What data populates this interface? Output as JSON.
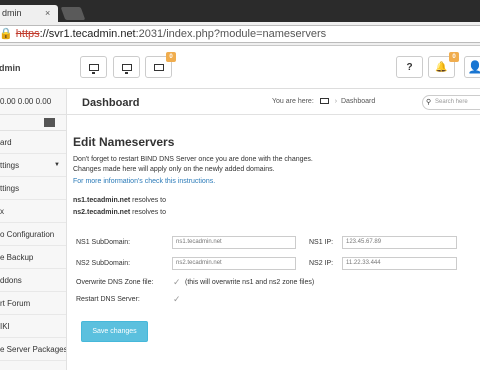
{
  "browser": {
    "tab_title": "dmin",
    "tab_close": "×",
    "url_lock": "🔒",
    "url_scheme": "https",
    "url_host": "://svr1.tecadmin.net",
    "url_rest": ":2031/index.php?module=nameservers"
  },
  "header": {
    "brand": "dmin",
    "badge_left": "0",
    "badge_right": "0",
    "help_label": "?"
  },
  "sidebar": {
    "load": "0.00 0.00 0.00",
    "items": [
      {
        "label": "ard"
      },
      {
        "label": "ttings"
      },
      {
        "label": "ttings"
      },
      {
        "label": "x"
      },
      {
        "label": "o Configuration"
      },
      {
        "label": "e Backup"
      },
      {
        "label": "ddons"
      },
      {
        "label": "rt Forum"
      },
      {
        "label": "IKI"
      },
      {
        "label": "e Server Packages"
      }
    ]
  },
  "breadcrumb": {
    "title": "Dashboard",
    "you_are_here": "You are here:",
    "sep": "›",
    "current": "Dashboard",
    "search_placeholder": "Search here"
  },
  "main": {
    "heading": "Edit Nameservers",
    "note1": "Don't forget to restart BIND DNS Server once you are done with the changes.",
    "note2": "Changes made here will apply only on the newly added domains.",
    "more_link": "For more information's check this instructions.",
    "ns1_host": "ns1.tecadmin.net",
    "ns2_host": "ns2.tecadmin.net",
    "resolves_to": "resolves to",
    "ns1_sub_label": "NS1 SubDomain:",
    "ns1_sub_value": "ns1.tecadmin.net",
    "ns1_ip_label": "NS1 IP:",
    "ns1_ip_value": "123.45.67.89",
    "ns2_sub_label": "NS2 SubDomain:",
    "ns2_sub_value": "ns2.tecadmin.net",
    "ns2_ip_label": "NS2 IP:",
    "ns2_ip_value": "11.22.33.444",
    "overwrite_label": "Overwrite DNS Zone file:",
    "overwrite_note": "(this will overwrite ns1 and ns2 zone files)",
    "restart_label": "Restart DNS Server:",
    "check_mark": "✓",
    "save_label": "Save changes"
  }
}
